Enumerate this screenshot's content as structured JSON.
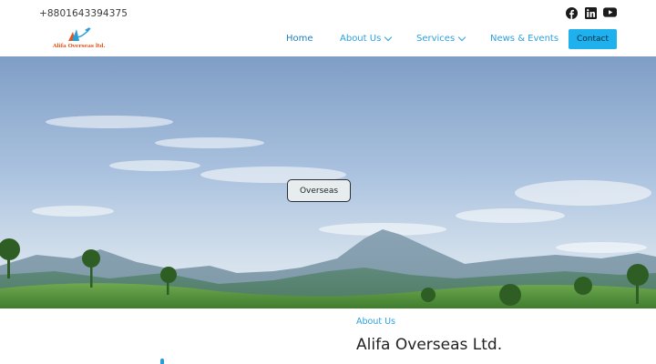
{
  "header": {
    "phone": "+8801643394375",
    "logo": {
      "text": "Alifa Overseas ltd.",
      "icon": "airplane-logo-icon"
    },
    "social": [
      {
        "name": "facebook",
        "icon": "facebook-icon"
      },
      {
        "name": "linkedin",
        "icon": "linkedin-icon"
      },
      {
        "name": "youtube",
        "icon": "youtube-icon"
      }
    ]
  },
  "nav": {
    "items": [
      {
        "label": "Home",
        "active": true,
        "dropdown": false
      },
      {
        "label": "About Us",
        "active": false,
        "dropdown": true
      },
      {
        "label": "Services",
        "active": false,
        "dropdown": true
      },
      {
        "label": "News & Events",
        "active": false,
        "dropdown": false
      }
    ],
    "contact_label": "Contact"
  },
  "hero": {
    "button_label": "Overseas",
    "image": "mountain-landscape"
  },
  "about": {
    "label": "About Us",
    "title": "Alifa Overseas Ltd."
  },
  "colors": {
    "accent": "#2ca0de",
    "contact_bg": "#1fb0ee",
    "logo_text": "#e4571f"
  }
}
